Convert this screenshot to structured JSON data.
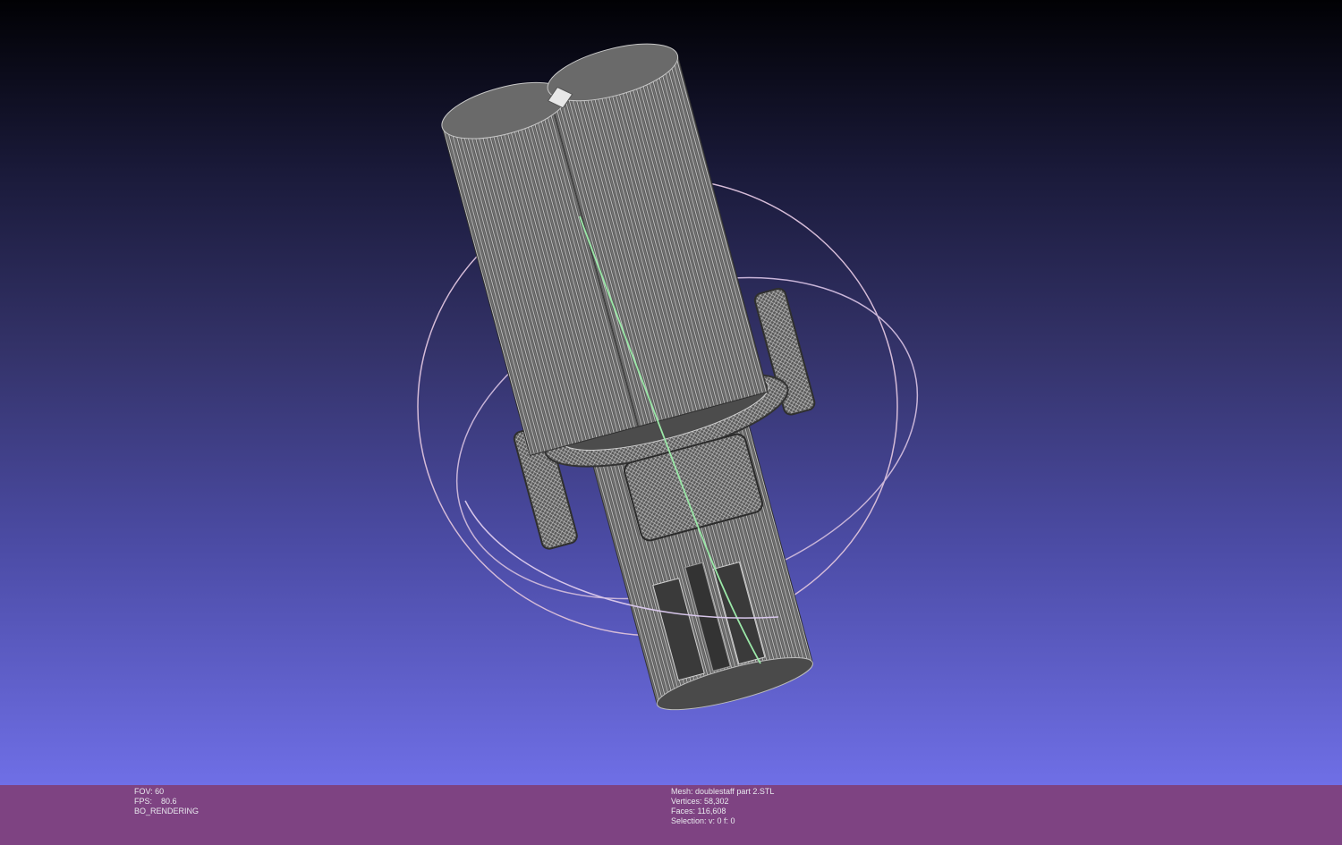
{
  "viewport": {
    "background_top": "#010104",
    "background_bottom": "#6f6fe6",
    "mesh_color": "#555555",
    "wire_color": "#e6e6e6",
    "trackball_color": "#d8c4e0",
    "axis_color": "#9be8a8"
  },
  "status": {
    "left": {
      "fov": "FOV: 60",
      "fps": "FPS:    80.6",
      "mode": "BO_RENDERING"
    },
    "right": {
      "mesh": "Mesh: doublestaff part 2.STL",
      "vertices": "Vertices: 58,302",
      "faces": "Faces: 116,608",
      "selection": "Selection: v: 0 f: 0"
    },
    "bar_color": "#7e4382"
  }
}
